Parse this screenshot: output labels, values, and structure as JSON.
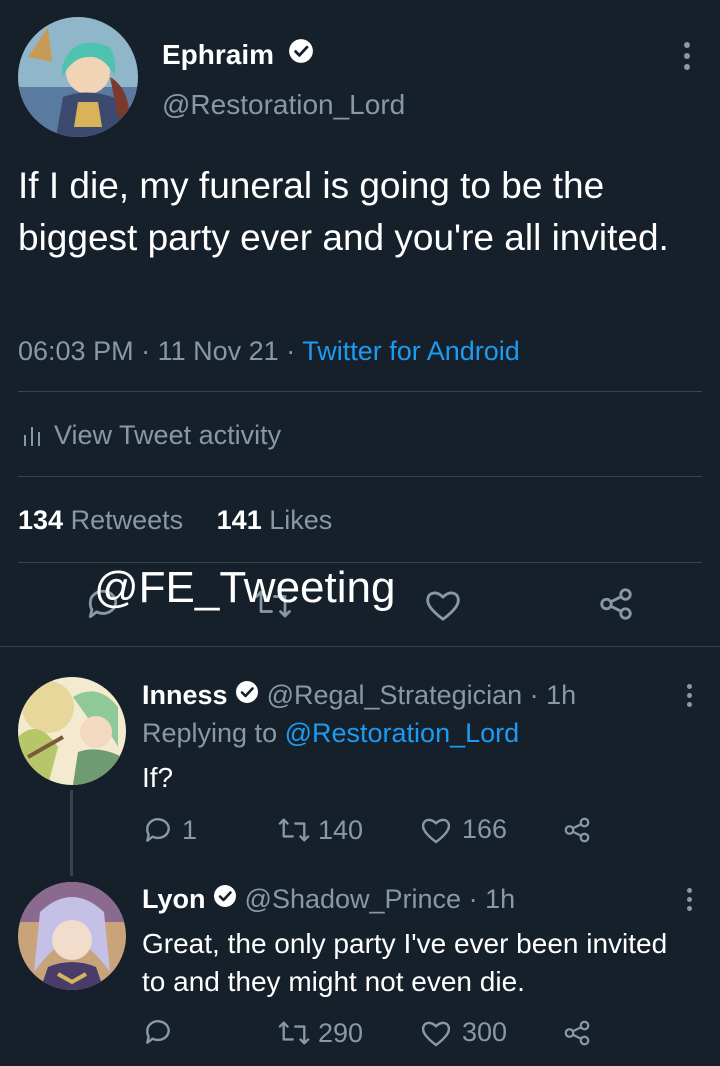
{
  "colors": {
    "background": "#15202b",
    "accent": "#1d9bf0",
    "muted": "#8899a6",
    "divider": "#38444d"
  },
  "main_tweet": {
    "display_name": "Ephraim",
    "handle": "@Restoration_Lord",
    "text": "If I die, my funeral is going to be the biggest party ever and you're all invited.",
    "time": "06:03 PM",
    "date": "11 Nov 21",
    "source": "Twitter for Android",
    "activity_label": "View Tweet activity",
    "retweets_count": "134",
    "retweets_label": "Retweets",
    "likes_count": "141",
    "likes_label": "Likes"
  },
  "watermark": "@FE_Tweeting",
  "replies": [
    {
      "display_name": "Inness",
      "handle": "@Regal_Strategician",
      "time": "· 1h",
      "replying_prefix": "Replying to",
      "replying_handle": "@Restoration_Lord",
      "text": "If?",
      "replies": "1",
      "retweets": "140",
      "likes": "166"
    },
    {
      "display_name": "Lyon",
      "handle": "@Shadow_Prince",
      "time": "· 1h",
      "text": "Great, the only party I've ever been invited to and they might not even die.",
      "replies": "",
      "retweets": "290",
      "likes": "300"
    }
  ]
}
